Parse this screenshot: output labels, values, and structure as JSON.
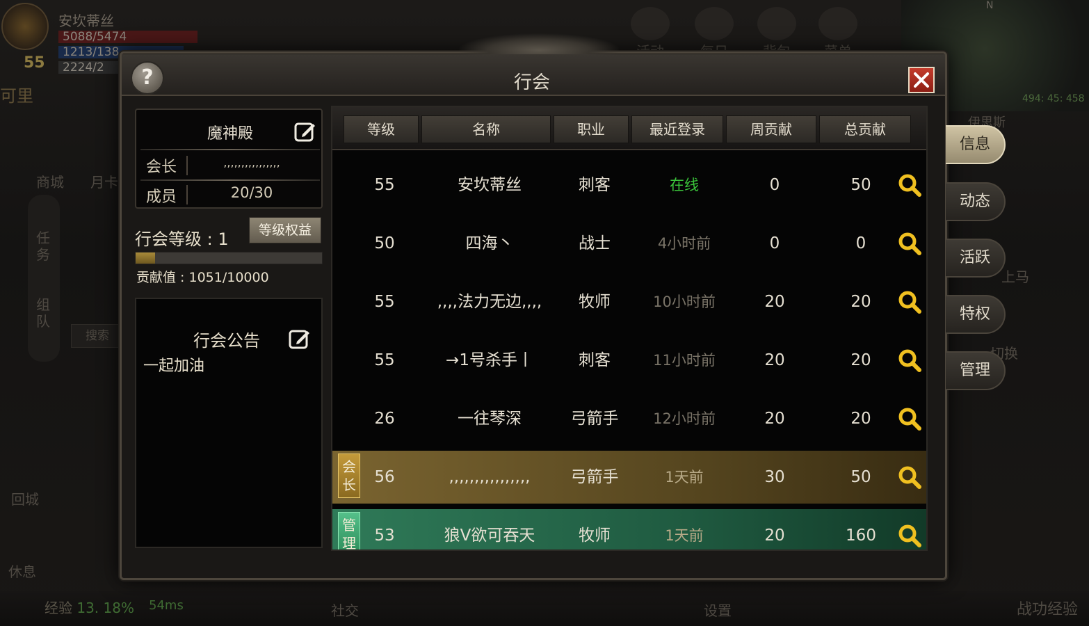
{
  "background": {
    "player": {
      "name": "安坎蒂丝",
      "level": "55",
      "hp": "5088/5474",
      "mp": "1213/138",
      "xp": "2224/2"
    },
    "top_menu": [
      "活动",
      "每日",
      "背包",
      "菜单"
    ],
    "minimap": {
      "north": "N",
      "coords": "494: 45: 458",
      "area": "伊思斯"
    },
    "left_menu": [
      "商城",
      "月卡"
    ],
    "left_fragment": "可里",
    "vertical_tabs": [
      "任务",
      "组队"
    ],
    "search_placeholder": "搜索",
    "return_city": "回城",
    "rest": "休息",
    "mount": "上马",
    "switch": "切换",
    "exp_label": "经验",
    "exp_pct": "13. 18%",
    "ping": "54ms",
    "social": "社交",
    "settings": "设置",
    "battle_exp": "战功经验"
  },
  "dialog": {
    "title": "行会",
    "help_label": "?",
    "guild_name": "魔神殿",
    "leader_label": "会长",
    "leader_value": ",,,,,,,,,,,,,,,,",
    "members_label": "成员",
    "members_value": "20/30",
    "level_label": "行会等级 : 1",
    "level_benefits_button": "等级权益",
    "contribution_text": "贡献值 : 1051/10000",
    "contribution_fraction": 0.1051,
    "notice_title": "行会公告",
    "notice_text": "一起加油"
  },
  "table": {
    "headers": [
      "等级",
      "名称",
      "职业",
      "最近登录",
      "周贡献",
      "总贡献"
    ],
    "rows": [
      {
        "level": "55",
        "name": "安坎蒂丝",
        "class": "刺客",
        "login": "在线",
        "weekly": "0",
        "total": "50",
        "role": ""
      },
      {
        "level": "50",
        "name": "四海丶",
        "class": "战士",
        "login": "4小时前",
        "weekly": "0",
        "total": "0",
        "role": ""
      },
      {
        "level": "55",
        "name": ",,,,法力无边,,,,",
        "class": "牧师",
        "login": "10小时前",
        "weekly": "20",
        "total": "20",
        "role": ""
      },
      {
        "level": "55",
        "name": "→1号杀手丨",
        "class": "刺客",
        "login": "11小时前",
        "weekly": "20",
        "total": "20",
        "role": ""
      },
      {
        "level": "26",
        "name": "一往琴深",
        "class": "弓箭手",
        "login": "12小时前",
        "weekly": "20",
        "total": "20",
        "role": ""
      },
      {
        "level": "56",
        "name": ",,,,,,,,,,,,,,,,",
        "class": "弓箭手",
        "login": "1天前",
        "weekly": "30",
        "total": "50",
        "role": "会长"
      },
      {
        "level": "53",
        "name": "狼V欲可吞天",
        "class": "牧师",
        "login": "1天前",
        "weekly": "20",
        "total": "160",
        "role": "管理"
      }
    ]
  },
  "side_tabs": [
    "信息",
    "动态",
    "活跃",
    "特权",
    "管理"
  ],
  "colors": {
    "online": "#3ac23a",
    "leader_row": "#7a6430",
    "manager_row": "#2f7a58",
    "close": "#c43c2c",
    "inspect": "#f0c020"
  }
}
